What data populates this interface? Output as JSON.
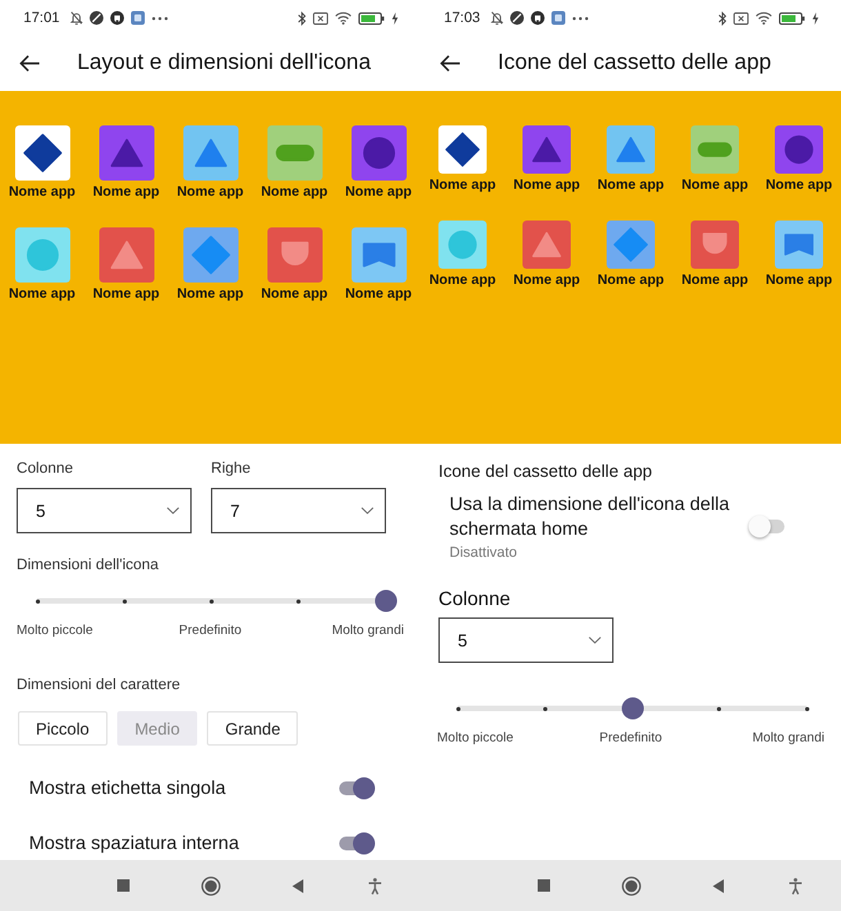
{
  "screens": [
    {
      "status_bar": {
        "time": "17:01"
      },
      "title": "Layout e dimensioni dell'icona",
      "preview": {
        "apps": [
          {
            "label": "Nome app",
            "color": "#ffffff",
            "glyph": {
              "kind": "diamond",
              "color": "#0f3b9c"
            }
          },
          {
            "label": "Nome app",
            "color": "#8f45ee",
            "glyph": {
              "kind": "triangle",
              "color": "#4b1aa6"
            }
          },
          {
            "label": "Nome app",
            "color": "#72c4f1",
            "glyph": {
              "kind": "triangle",
              "color": "#1f80ee"
            }
          },
          {
            "label": "Nome app",
            "color": "#a0d07c",
            "glyph": {
              "kind": "pill",
              "color": "#50a11e"
            }
          },
          {
            "label": "Nome app",
            "color": "#8f45ee",
            "glyph": {
              "kind": "circle",
              "color": "#4b1aa6"
            }
          },
          {
            "label": "Nome app",
            "color": "#80e2ef",
            "glyph": {
              "kind": "circle",
              "color": "#2ec5da"
            }
          },
          {
            "label": "Nome app",
            "color": "#e2524b",
            "glyph": {
              "kind": "triangle",
              "color": "#f28b86"
            }
          },
          {
            "label": "Nome app",
            "color": "#6ea9ef",
            "glyph": {
              "kind": "diamond",
              "color": "#168cf4"
            }
          },
          {
            "label": "Nome app",
            "color": "#e2524b",
            "glyph": {
              "kind": "shield",
              "color": "#f28b86"
            }
          },
          {
            "label": "Nome app",
            "color": "#7dc7f4",
            "glyph": {
              "kind": "banner",
              "color": "#2a7fe6"
            }
          }
        ]
      },
      "settings": [
        {
          "kind": "dropdown_pair",
          "fields": [
            {
              "label": "Colonne",
              "value": "5"
            },
            {
              "label": "Righe",
              "value": "7"
            }
          ]
        },
        {
          "kind": "slider",
          "label": "Dimensioni dell'icona",
          "level": 1,
          "tick_labels": [
            "Molto piccole",
            "Predefinito",
            "Molto grandi"
          ]
        },
        {
          "kind": "segmented",
          "label": "Dimensioni del carattere",
          "options": [
            {
              "label": "Piccolo",
              "selected": false
            },
            {
              "label": "Medio",
              "selected": true
            },
            {
              "label": "Grande",
              "selected": false
            }
          ]
        },
        {
          "kind": "switch",
          "label": "Mostra etichetta singola",
          "on": true
        },
        {
          "kind": "switch",
          "label": "Mostra spaziatura interna",
          "on": true
        }
      ]
    },
    {
      "status_bar": {
        "time": "17:03"
      },
      "title": "Icone del cassetto delle app",
      "preview": {
        "apps": [
          {
            "label": "Nome app",
            "color": "#ffffff",
            "glyph": {
              "kind": "diamond",
              "color": "#0f3b9c"
            }
          },
          {
            "label": "Nome app",
            "color": "#8f45ee",
            "glyph": {
              "kind": "triangle",
              "color": "#4b1aa6"
            }
          },
          {
            "label": "Nome app",
            "color": "#72c4f1",
            "glyph": {
              "kind": "triangle",
              "color": "#1f80ee"
            }
          },
          {
            "label": "Nome app",
            "color": "#a0d07c",
            "glyph": {
              "kind": "pill",
              "color": "#50a11e"
            }
          },
          {
            "label": "Nome app",
            "color": "#8f45ee",
            "glyph": {
              "kind": "circle",
              "color": "#4b1aa6"
            }
          },
          {
            "label": "Nome app",
            "color": "#80e2ef",
            "glyph": {
              "kind": "circle",
              "color": "#2ec5da"
            }
          },
          {
            "label": "Nome app",
            "color": "#e2524b",
            "glyph": {
              "kind": "triangle",
              "color": "#f28b86"
            }
          },
          {
            "label": "Nome app",
            "color": "#6ea9ef",
            "glyph": {
              "kind": "diamond",
              "color": "#168cf4"
            }
          },
          {
            "label": "Nome app",
            "color": "#e2524b",
            "glyph": {
              "kind": "shield",
              "color": "#f28b86"
            }
          },
          {
            "label": "Nome app",
            "color": "#7dc7f4",
            "glyph": {
              "kind": "banner",
              "color": "#2a7fe6"
            }
          }
        ]
      },
      "settings": [
        {
          "kind": "header",
          "label": "Icone del cassetto delle app"
        },
        {
          "kind": "switch",
          "label": "Usa la dimensione dell'icona della schermata home",
          "summary": "Disattivato",
          "on": false
        },
        {
          "kind": "dropdown",
          "label": "Colonne",
          "value": "5"
        },
        {
          "kind": "slider",
          "level": 0.5,
          "tick_labels": [
            "Molto piccole",
            "Predefinito",
            "Molto grandi"
          ]
        }
      ]
    }
  ]
}
